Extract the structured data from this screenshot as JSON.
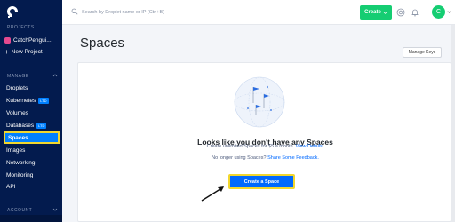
{
  "sidebar": {
    "projects_label": "PROJECTS",
    "project_name": "CatchPengui...",
    "new_project": "New Project",
    "manage_label": "MANAGE",
    "account_label": "ACCOUNT",
    "items": [
      {
        "label": "Droplets",
        "badge": ""
      },
      {
        "label": "Kubernetes",
        "badge": "LTD"
      },
      {
        "label": "Volumes",
        "badge": ""
      },
      {
        "label": "Databases",
        "badge": "LTD"
      },
      {
        "label": "Spaces",
        "badge": "",
        "active": true
      },
      {
        "label": "Images",
        "badge": ""
      },
      {
        "label": "Networking",
        "badge": ""
      },
      {
        "label": "Monitoring",
        "badge": ""
      },
      {
        "label": "API",
        "badge": ""
      }
    ]
  },
  "topbar": {
    "search_placeholder": "Search by Droplet name or IP (Ctrl+B)",
    "create_label": "Create",
    "avatar_initial": "C"
  },
  "main": {
    "title": "Spaces",
    "manage_keys_label": "Manage Keys",
    "empty_title": "Looks like you don't have any Spaces",
    "empty_desc": "Create unlimited Spaces for $5 a month.",
    "view_details_link": "View Details.",
    "feedback_text": "No longer using Spaces?",
    "feedback_link": "Share Some Feedback.",
    "create_space_label": "Create a Space"
  },
  "colors": {
    "sidebar_bg": "#031b4e",
    "accent_blue": "#0069ff",
    "create_green": "#15cd72",
    "highlight_yellow": "#f2d72e"
  }
}
